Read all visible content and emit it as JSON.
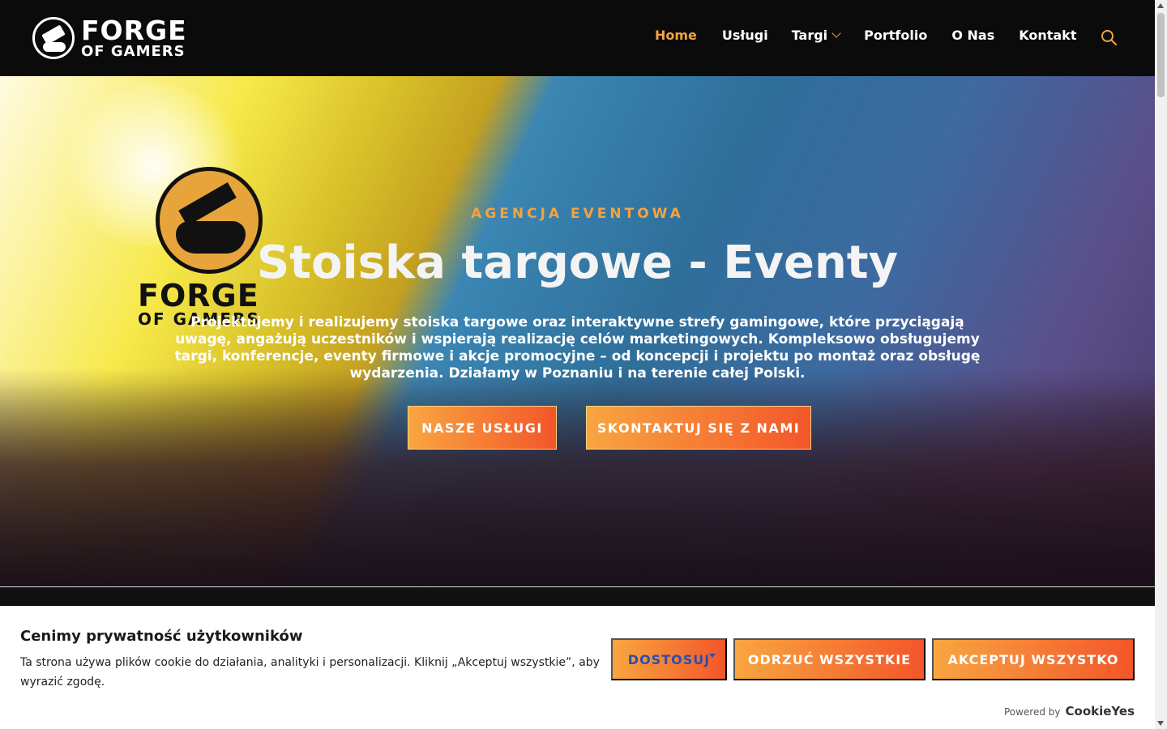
{
  "brand": {
    "line1": "FORGE",
    "line2": "OF GAMERS"
  },
  "nav": {
    "items": [
      {
        "label": "Home"
      },
      {
        "label": "Usługi"
      },
      {
        "label": "Targi"
      },
      {
        "label": "Portfolio"
      },
      {
        "label": "O Nas"
      },
      {
        "label": "Kontakt"
      }
    ]
  },
  "hero": {
    "eyebrow": "AGENCJA EVENTOWA",
    "title": "Stoiska targowe - Eventy",
    "description": "Projektujemy i realizujemy stoiska targowe oraz interaktywne strefy gamingowe, które przyciągają uwagę, angażują uczestników i wspierają realizację celów marketingowych. Kompleksowo obsługujemy targi, konferencje, eventy firmowe i akcje promocyjne – od koncepcji i projektu po montaż oraz obsługę wydarzenia. Działamy w Poznaniu i na terenie całej Polski.",
    "buttons": {
      "services": "NASZE USŁUGI",
      "contact": "SKONTAKTUJ SIĘ Z NAMI"
    },
    "logo": {
      "line1": "FORGE",
      "line2": "OF GAMERS"
    }
  },
  "cookie": {
    "title": "Cenimy prywatność użytkowników",
    "text": "Ta strona używa plików cookie do działania, analityki i personalizacji. Kliknij „Akceptuj wszystkie”, aby wyrazić zgodę.",
    "customize": "DOSTOSUJ",
    "reject": "ODRZUĆ WSZYSTKIE",
    "accept": "AKCEPTUJ WSZYSTKO",
    "powered_by": "Powered by",
    "powered_brand": "CookieYes"
  },
  "colors": {
    "accent": "#f4a340",
    "header_bg": "#0b0b0b",
    "button_start": "#f8a640",
    "button_end": "#f3562a",
    "customize_text": "#2e4ea8"
  },
  "icons": {
    "search": "search-icon",
    "dropdown": "chevron-down-icon"
  }
}
